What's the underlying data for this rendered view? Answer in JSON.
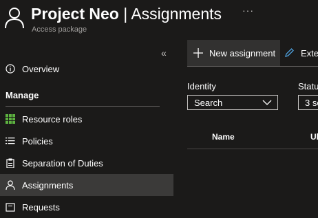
{
  "header": {
    "title_project": "Project Neo",
    "title_sep": " | ",
    "title_page": "Assignments",
    "subtitle": "Access package",
    "more": "···"
  },
  "sidebar": {
    "collapse_glyph": "«",
    "items_top": [
      {
        "label": "Overview",
        "icon": "info-icon"
      }
    ],
    "section": "Manage",
    "items": [
      {
        "label": "Resource roles",
        "icon": "grid-icon"
      },
      {
        "label": "Policies",
        "icon": "list-icon"
      },
      {
        "label": "Separation of Duties",
        "icon": "clipboard-icon"
      },
      {
        "label": "Assignments",
        "icon": "user-icon",
        "active": true
      },
      {
        "label": "Requests",
        "icon": "requests-icon"
      }
    ]
  },
  "toolbar": {
    "new_assignment": "New assignment",
    "extend": "Exte"
  },
  "filters": {
    "identity_label": "Identity",
    "identity_value": "Search",
    "status_label": "Statu",
    "status_value": "3 se"
  },
  "table": {
    "columns": [
      "Name",
      "Ul"
    ]
  },
  "colors": {
    "background": "#1b1a19",
    "active_item": "#3b3a39",
    "grid_icon_green": "#5db240"
  }
}
